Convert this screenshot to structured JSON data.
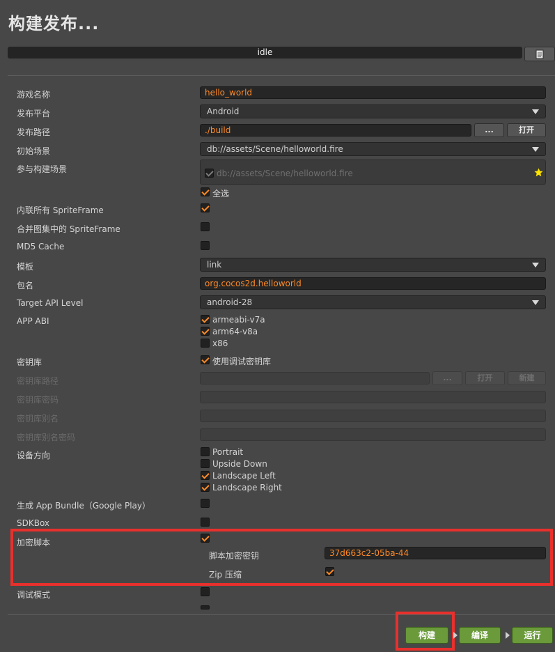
{
  "title": "构建发布...",
  "status": "idle",
  "fields": {
    "game_name": {
      "label": "游戏名称",
      "value": "hello_world"
    },
    "platform": {
      "label": "发布平台",
      "value": "Android"
    },
    "build_path": {
      "label": "发布路径",
      "value": "./build",
      "browse": "...",
      "open": "打开"
    },
    "start_scene": {
      "label": "初始场景",
      "value": "db://assets/Scene/helloworld.fire"
    },
    "scenes": {
      "label": "参与构建场景",
      "item": "db://assets/Scene/helloworld.fire",
      "select_all": "全选"
    },
    "inline_spriteframe": {
      "label": "内联所有 SpriteFrame"
    },
    "merge_spriteframe": {
      "label": "合并图集中的 SpriteFrame"
    },
    "md5_cache": {
      "label": "MD5 Cache"
    },
    "template": {
      "label": "模板",
      "value": "link"
    },
    "package_name": {
      "label": "包名",
      "value": "org.cocos2d.helloworld"
    },
    "target_api": {
      "label": "Target API Level",
      "value": "android-28"
    },
    "app_abi": {
      "label": "APP ABI",
      "options": [
        "armeabi-v7a",
        "arm64-v8a",
        "x86"
      ]
    },
    "keystore": {
      "label": "密钥库",
      "option": "使用调试密钥库"
    },
    "keystore_path": {
      "label": "密钥库路径",
      "browse": "...",
      "open": "打开",
      "new": "新建"
    },
    "keystore_password": {
      "label": "密钥库密码"
    },
    "keystore_alias": {
      "label": "密钥库别名"
    },
    "keystore_alias_password": {
      "label": "密钥库别名密码"
    },
    "orientation": {
      "label": "设备方向",
      "options": [
        "Portrait",
        "Upside Down",
        "Landscape Left",
        "Landscape Right"
      ]
    },
    "app_bundle": {
      "label": "生成 App Bundle（Google Play）"
    },
    "sdkbox": {
      "label": "SDKBox"
    },
    "encrypt": {
      "label": "加密脚本",
      "key_label": "脚本加密密钥",
      "key_value": "37d663c2-05ba-44",
      "zip_label": "Zip 压缩"
    },
    "debug": {
      "label": "调试模式"
    }
  },
  "actions": {
    "build": "构建",
    "compile": "编译",
    "run": "运行"
  },
  "colors": {
    "accent": "#ff8a26",
    "highlight": "#e8302c",
    "action_green": "#6a9a3a"
  }
}
